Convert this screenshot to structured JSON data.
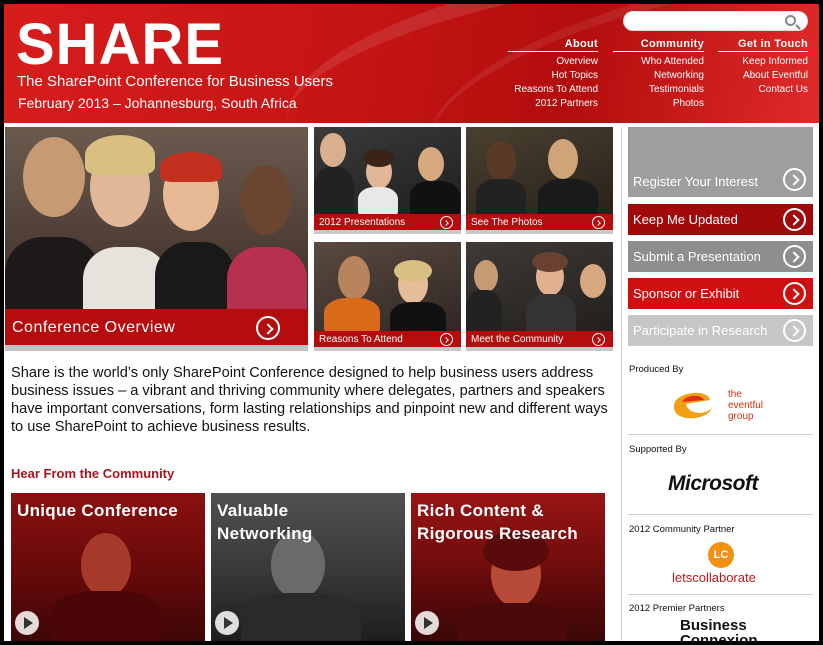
{
  "header": {
    "logo": "SHARE",
    "tagline": "The SharePoint Conference for Business Users",
    "dateline": "February 2013 – Johannesburg, South Africa",
    "search": {
      "placeholder": "",
      "icon": "search-icon"
    },
    "nav": [
      {
        "title": "About",
        "links": [
          "Overview",
          "Hot Topics",
          "Reasons To Attend",
          "2012 Partners"
        ]
      },
      {
        "title": "Community",
        "links": [
          "Who Attended",
          "Networking",
          "Testimonials",
          "Photos"
        ]
      },
      {
        "title": "Get in Touch",
        "links": [
          "Keep Informed",
          "About Eventful",
          "Contact Us"
        ]
      }
    ]
  },
  "tiles": {
    "overview": "Conference Overview",
    "presentations": "2012 Presentations",
    "photos": "See The Photos",
    "reasons": "Reasons To Attend",
    "community": "Meet the Community"
  },
  "sidebar": {
    "buttons": [
      {
        "label": "Register Your Interest",
        "color": "#9e9e9e"
      },
      {
        "label": "Keep Me Updated",
        "color": "#a10a0a"
      },
      {
        "label": "Submit a Presentation",
        "color": "#8e8e8e"
      },
      {
        "label": "Sponsor or Exhibit",
        "color": "#d01010"
      },
      {
        "label": "Participate in Research",
        "color": "#c6c6c6"
      }
    ],
    "produced_by": "Produced By",
    "eventful": {
      "line1": "the",
      "line2": "eventful",
      "line3": "group"
    },
    "supported_by": "Supported By",
    "microsoft": "Microsoft",
    "community_partner": "2012 Community Partner",
    "letscollaborate": "letscollaborate",
    "lc_badge": "LC",
    "premier_partners": "2012 Premier Partners",
    "business_connexion": {
      "line1": "Business",
      "line2": "Connexion"
    }
  },
  "intro": "Share is the world’s only SharePoint Conference designed to help business users address business issues – a vibrant and thriving community where delegates, partners and speakers have important conversations, form lasting relationships and pinpoint new and different ways to use SharePoint to achieve business results.",
  "hear_heading": "Hear From the Community",
  "videos": [
    {
      "title_line1": "Unique Conference",
      "title_line2": ""
    },
    {
      "title_line1": "Valuable",
      "title_line2": "Networking"
    },
    {
      "title_line1": "Rich Content &",
      "title_line2": "Rigorous Research"
    }
  ],
  "colors": {
    "brand_red": "#c41414",
    "dark_red": "#a8141e"
  }
}
